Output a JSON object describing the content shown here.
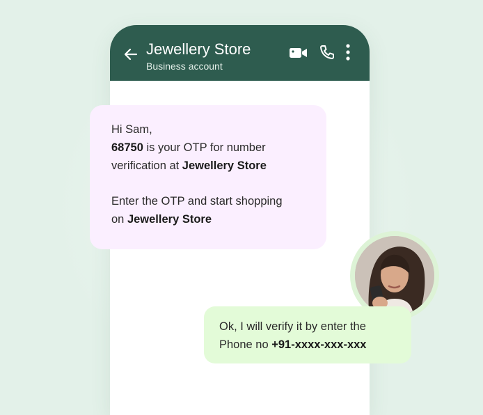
{
  "header": {
    "title": "Jewellery Store",
    "subtitle": "Business account",
    "back_icon": "arrow-left-icon",
    "video_icon": "video-camera-icon",
    "call_icon": "phone-icon",
    "menu_icon": "more-vertical-icon"
  },
  "messages": {
    "incoming": {
      "greeting": "Hi Sam,",
      "otp_code": "68750",
      "otp_text": " is your OTP for number",
      "verify_text": "verification at ",
      "store_name_1": "Jewellery Store",
      "enter_text": "Enter the OTP and start shopping",
      "on_text": "on ",
      "store_name_2": "Jewellery Store"
    },
    "outgoing": {
      "line1": "Ok, I will verify it by enter the",
      "phone_label": "Phone no ",
      "phone_number": "+91-xxxx-xxx-xxx"
    }
  },
  "colors": {
    "header_bg": "#2e5c4f",
    "page_bg": "#e3f1e9",
    "incoming_bubble": "#fbefff",
    "outgoing_bubble": "#e3fbd8"
  }
}
